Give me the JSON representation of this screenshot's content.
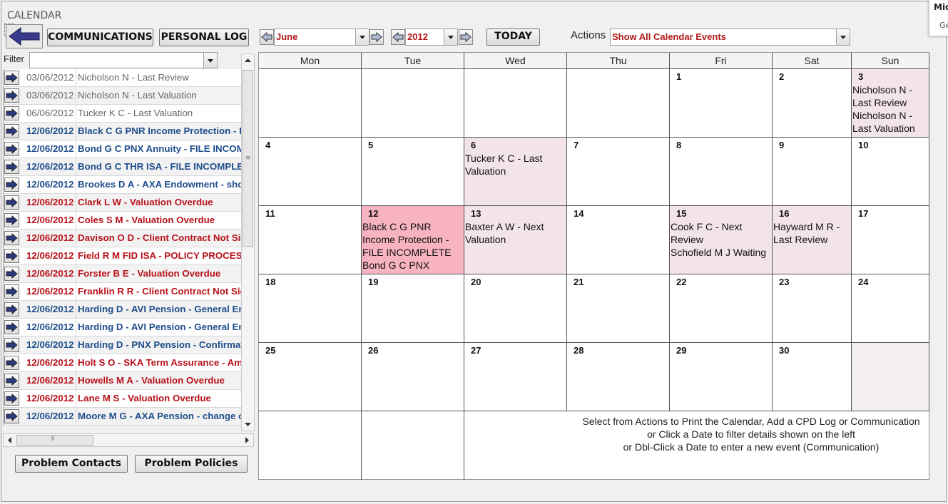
{
  "window": {
    "title": "CALENDAR"
  },
  "corner_popup": {
    "line1": "Mic",
    "line2": "Ge"
  },
  "toolbar": {
    "communications_label": "COMMUNICATIONS",
    "personal_log_label": "PERSONAL LOG",
    "month_value": "June",
    "year_value": "2012",
    "today_label": "TODAY",
    "actions_label": "Actions",
    "actions_value": "Show All Calendar Events"
  },
  "filter": {
    "label": "Filter",
    "value": ""
  },
  "list": [
    {
      "date": "03/06/2012",
      "text": "Nicholson N - Last Review",
      "style": "grey"
    },
    {
      "date": "03/06/2012",
      "text": "Nicholson N - Last Valuation",
      "style": "grey"
    },
    {
      "date": "06/06/2012",
      "text": "Tucker K C - Last Valuation",
      "style": "grey"
    },
    {
      "date": "12/06/2012",
      "text": "Black C G PNR Income Protection - FILE INCOMPLETE",
      "style": "blue"
    },
    {
      "date": "12/06/2012",
      "text": "Bond G C PNX Annuity - FILE INCOMPLETE",
      "style": "blue"
    },
    {
      "date": "12/06/2012",
      "text": "Bond G C THR ISA - FILE INCOMPLETE",
      "style": "blue"
    },
    {
      "date": "12/06/2012",
      "text": "Brookes D A - AXA Endowment - shortfall",
      "style": "blue"
    },
    {
      "date": "12/06/2012",
      "text": "Clark L W - Valuation Overdue",
      "style": "red"
    },
    {
      "date": "12/06/2012",
      "text": "Coles S M - Valuation Overdue",
      "style": "red"
    },
    {
      "date": "12/06/2012",
      "text": "Davison O D - Client Contract Not Signed",
      "style": "red"
    },
    {
      "date": "12/06/2012",
      "text": "Field R M FID ISA - POLICY PROCESSING",
      "style": "red"
    },
    {
      "date": "12/06/2012",
      "text": "Forster B E - Valuation Overdue",
      "style": "red"
    },
    {
      "date": "12/06/2012",
      "text": "Franklin R R - Client Contract Not Signed",
      "style": "red"
    },
    {
      "date": "12/06/2012",
      "text": "Harding D - AVI Pension - General Enquiry",
      "style": "blue"
    },
    {
      "date": "12/06/2012",
      "text": "Harding D - AVI Pension - General Enquiry",
      "style": "blue"
    },
    {
      "date": "12/06/2012",
      "text": "Harding D - PNX Pension - Confirmation",
      "style": "blue"
    },
    {
      "date": "12/06/2012",
      "text": "Holt S O - SKA Term Assurance - Amendment",
      "style": "red"
    },
    {
      "date": "12/06/2012",
      "text": "Howells M A - Valuation Overdue",
      "style": "red"
    },
    {
      "date": "12/06/2012",
      "text": "Lane M S - Valuation Overdue",
      "style": "red"
    },
    {
      "date": "12/06/2012",
      "text": "Moore M G - AXA Pension - change of",
      "style": "blue"
    }
  ],
  "bottom_buttons": {
    "problem_contacts": "Problem Contacts",
    "problem_policies": "Problem Policies"
  },
  "calendar": {
    "days": [
      "Mon",
      "Tue",
      "Wed",
      "Thu",
      "Fri",
      "Sat",
      "Sun"
    ],
    "weeks": [
      [
        {
          "day": "",
          "events": []
        },
        {
          "day": "",
          "events": []
        },
        {
          "day": "",
          "events": []
        },
        {
          "day": "",
          "events": []
        },
        {
          "day": "1",
          "events": []
        },
        {
          "day": "2",
          "events": []
        },
        {
          "day": "3",
          "events": [
            "Nicholson N - Last Review",
            "Nicholson N - Last Valuation"
          ],
          "style": "pink"
        }
      ],
      [
        {
          "day": "4",
          "events": []
        },
        {
          "day": "5",
          "events": []
        },
        {
          "day": "6",
          "events": [
            "Tucker K C - Last Valuation"
          ],
          "style": "pink"
        },
        {
          "day": "7",
          "events": []
        },
        {
          "day": "8",
          "events": []
        },
        {
          "day": "9",
          "events": []
        },
        {
          "day": "10",
          "events": []
        }
      ],
      [
        {
          "day": "11",
          "events": []
        },
        {
          "day": "12",
          "events": [
            "Black C G PNR Income Protection - FILE INCOMPLETE",
            "Bond G C PNX Annuity - FILE INCOMPLETE"
          ],
          "style": "hot"
        },
        {
          "day": "13",
          "events": [
            "Baxter A W - Next Valuation"
          ],
          "style": "pink"
        },
        {
          "day": "14",
          "events": []
        },
        {
          "day": "15",
          "events": [
            "Cook F C - Next Review",
            "Schofield M J Waiting"
          ],
          "style": "pink"
        },
        {
          "day": "16",
          "events": [
            "Hayward M R - Last Review"
          ],
          "style": "pink"
        },
        {
          "day": "17",
          "events": []
        }
      ],
      [
        {
          "day": "18",
          "events": []
        },
        {
          "day": "19",
          "events": []
        },
        {
          "day": "20",
          "events": []
        },
        {
          "day": "21",
          "events": []
        },
        {
          "day": "22",
          "events": []
        },
        {
          "day": "23",
          "events": []
        },
        {
          "day": "24",
          "events": []
        }
      ],
      [
        {
          "day": "25",
          "events": []
        },
        {
          "day": "26",
          "events": []
        },
        {
          "day": "27",
          "events": []
        },
        {
          "day": "28",
          "events": []
        },
        {
          "day": "29",
          "events": []
        },
        {
          "day": "30",
          "events": []
        },
        {
          "day": "",
          "events": [],
          "style": "out"
        }
      ]
    ],
    "info_lines": [
      "Select from Actions to Print the Calendar, Add a CPD Log or Communication",
      "or Click a Date to filter details shown on the left",
      "or Dbl-Click a Date to enter a new event (Communication)"
    ]
  }
}
